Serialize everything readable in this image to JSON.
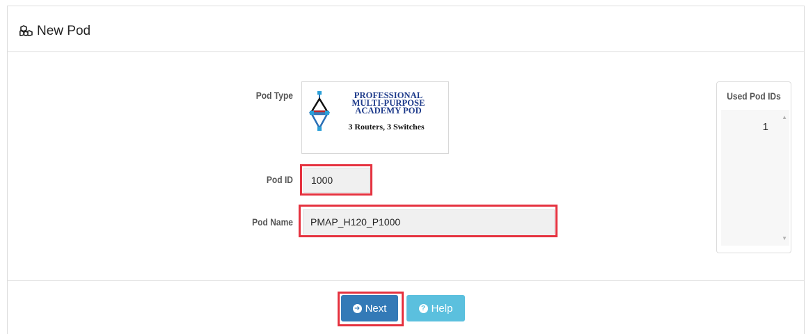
{
  "header": {
    "title": "New Pod",
    "icon": "cubes-icon"
  },
  "form": {
    "pod_type_label": "Pod Type",
    "pod_type_logo": {
      "lines": [
        "PROFESSIONAL",
        "MULTI-PURPOSE",
        "ACADEMY POD"
      ],
      "subtitle": "3 Routers, 3 Switches"
    },
    "pod_id_label": "Pod ID",
    "pod_id_value": "1000",
    "pod_name_label": "Pod Name",
    "pod_name_value": "PMAP_H120_P1000"
  },
  "used_ids": {
    "title": "Used Pod IDs",
    "items": [
      "1"
    ]
  },
  "buttons": {
    "next_label": "Next",
    "help_label": "Help"
  },
  "colors": {
    "highlight": "#e5323f",
    "primary": "#337ab7",
    "info": "#5bc0de"
  }
}
